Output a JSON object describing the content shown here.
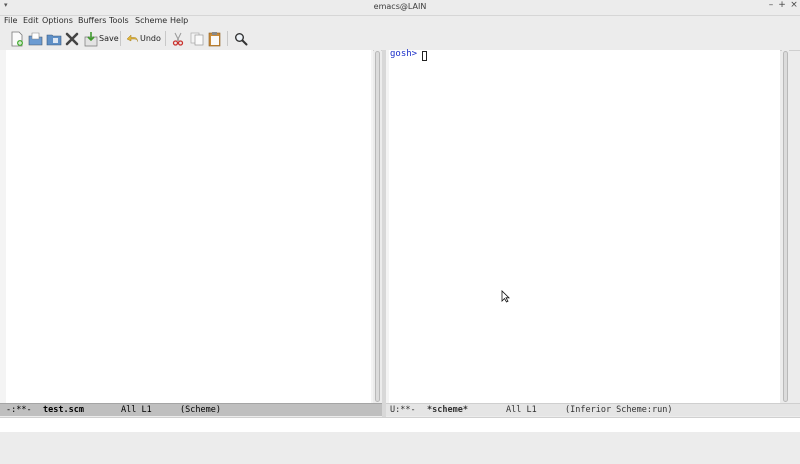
{
  "window": {
    "title": "emacs@LAIN"
  },
  "menu": [
    "File",
    "Edit",
    "Options",
    "Buffers",
    "Tools",
    "Scheme",
    "Help"
  ],
  "toolbar": {
    "save_label": "Save",
    "undo_label": "Undo"
  },
  "icons": {
    "new_file": "new-file-icon",
    "open_file": "open-file-icon",
    "open_dir": "open-directory-icon",
    "close": "close-icon",
    "save": "save-icon",
    "undo": "undo-icon",
    "cut": "cut-icon",
    "copy": "copy-icon",
    "paste": "paste-icon",
    "search": "search-icon"
  },
  "left_window": {
    "modeline": {
      "status": "-:**-",
      "buffer": "test.scm",
      "position": "All L1",
      "mode": "(Scheme)"
    }
  },
  "right_window": {
    "prompt": "gosh>",
    "modeline": {
      "status": "U:**-",
      "buffer": "*scheme*",
      "position": "All L1",
      "mode": "(Inferior Scheme:run)"
    }
  },
  "colors": {
    "prompt": "#1b2fc9",
    "active_modeline": "#bfbfbf",
    "inactive_modeline": "#e5e5e5"
  }
}
